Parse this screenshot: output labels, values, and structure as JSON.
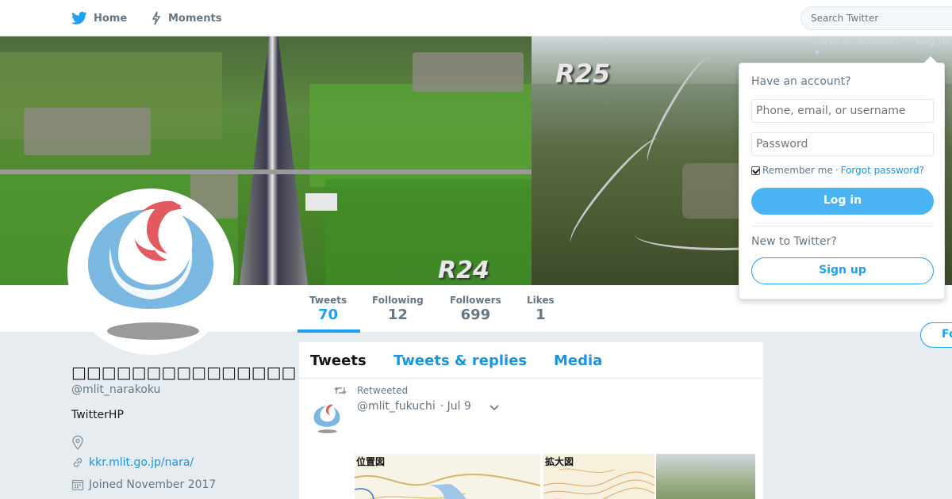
{
  "nav": {
    "home_label": "Home",
    "moments_label": "Moments",
    "search_placeholder": "Search Twitter",
    "brand_color": "#1da1f2"
  },
  "banner": {
    "left_label": "R24",
    "right_label": "R25"
  },
  "stats": [
    {
      "label": "Tweets",
      "value": "70"
    },
    {
      "label": "Following",
      "value": "12"
    },
    {
      "label": "Followers",
      "value": "699"
    },
    {
      "label": "Likes",
      "value": "1"
    }
  ],
  "follow_button_label": "Fo",
  "profile": {
    "name": "□□□□□□□□□□□□□□□",
    "handle": "@mlit_narakoku",
    "bio": "TwitterHP",
    "url": "kkr.mlit.go.jp/nara/",
    "joined": "Joined November 2017"
  },
  "timeline": {
    "tabs": [
      "Tweets",
      "Tweets & replies",
      "Media"
    ],
    "retweet_label": "Retweeted",
    "tweet_handle": "@mlit_fukuchi",
    "tweet_date": "· Jul 9",
    "media_labels": [
      "位置図",
      "拡大図"
    ]
  },
  "login_hint": {
    "text": "Have an account?",
    "action": "Log in ▾"
  },
  "login_dropdown": {
    "title": "Have an account?",
    "username_placeholder": "Phone, email, or username",
    "password_placeholder": "Password",
    "remember_label": "Remember me",
    "separator": "·",
    "forgot_label": "Forgot password?",
    "login_button": "Log in",
    "new_label": "New to Twitter?",
    "signup_button": "Sign up"
  }
}
